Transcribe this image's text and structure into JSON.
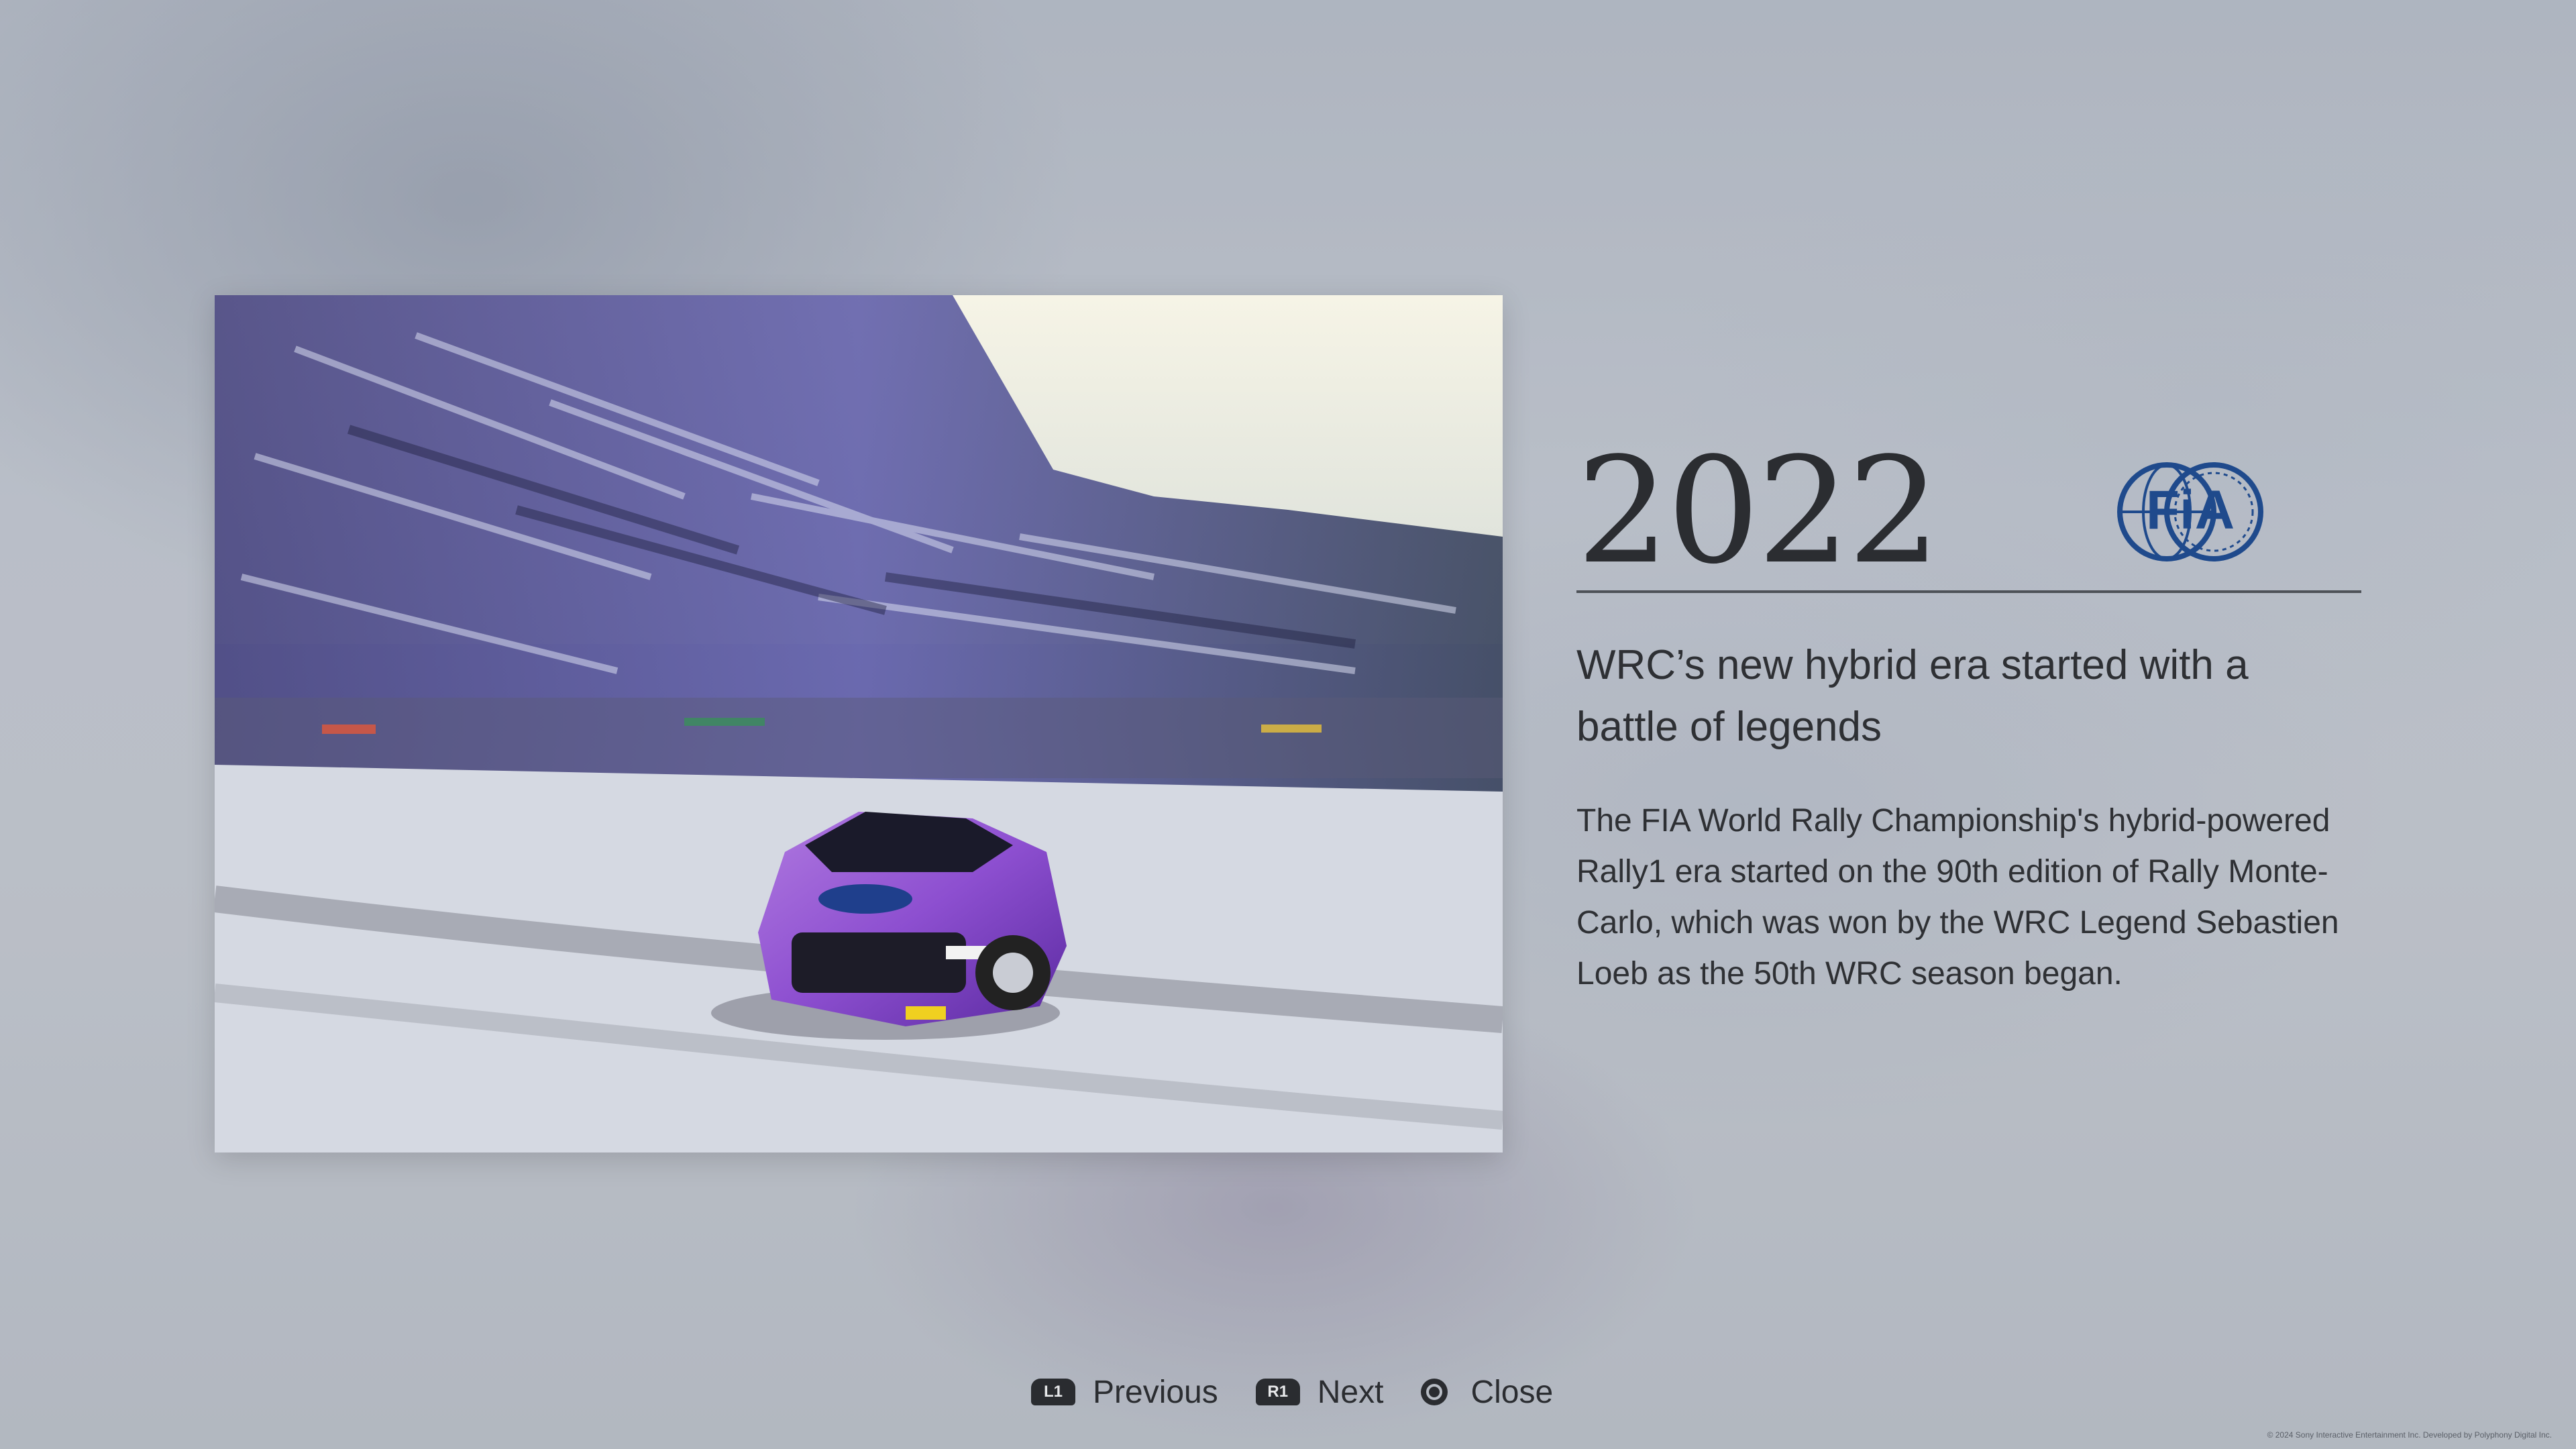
{
  "entry": {
    "year": "2022",
    "logo": "FIA",
    "headline": "WRC’s new hybrid era started with a battle of legends",
    "body": "The FIA World Rally Championship's hybrid-powered Rally1 era started on the 90th edition of Rally Monte-Carlo, which was won by the WRC Legend Sebastien Loeb as the 50th WRC season began."
  },
  "photo": {
    "subject": "rally-car-on-snow-photo"
  },
  "controls": {
    "previous": {
      "button": "L1",
      "label": "Previous"
    },
    "next": {
      "button": "R1",
      "label": "Next"
    },
    "close": {
      "button": "circle-icon",
      "label": "Close"
    }
  },
  "footer": {
    "copyright": "© 2024 Sony Interactive Entertainment Inc. Developed by Polyphony Digital Inc."
  },
  "colors": {
    "fia_blue": "#1f4a8c",
    "text": "#2e3034",
    "button_badge": "#2a2c30"
  }
}
